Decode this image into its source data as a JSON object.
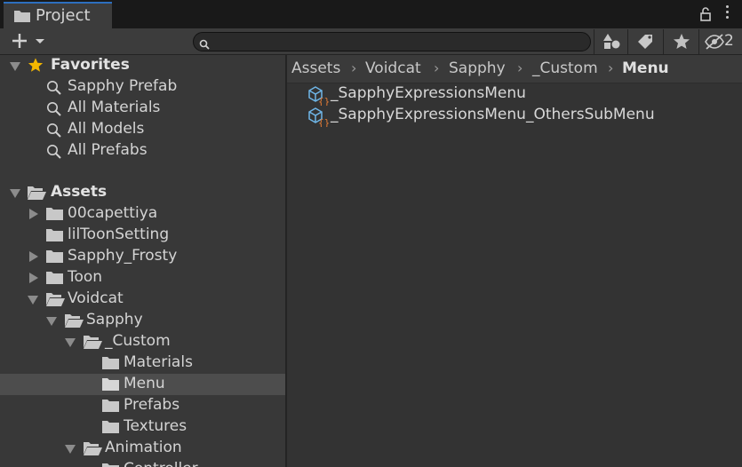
{
  "tab": {
    "title": "Project"
  },
  "toolbar": {
    "hidden_count": "2",
    "search_value": ""
  },
  "favorites": {
    "label": "Favorites",
    "items": [
      "Sapphy Prefab",
      "All Materials",
      "All Models",
      "All Prefabs"
    ]
  },
  "tree": {
    "root": "Assets",
    "items": [
      "00capettiya",
      "lilToonSetting",
      "Sapphy_Frosty",
      "Toon",
      "Voidcat",
      "Sapphy",
      "_Custom",
      "Materials",
      "Menu",
      "Prefabs",
      "Textures",
      "Animation",
      "Controller"
    ]
  },
  "breadcrumb": [
    "Assets",
    "Voidcat",
    "Sapphy",
    "_Custom",
    "Menu"
  ],
  "assets": [
    "_SapphyExpressionsMenu",
    "_SapphyExpressionsMenu_OthersSubMenu"
  ],
  "colors": {
    "accent_tab": "#2d6fbf",
    "star": "#f5b800",
    "asset_cube": "#6fb6e8",
    "asset_braces": "#e07a35",
    "selected_row": "#4d4d4d"
  }
}
